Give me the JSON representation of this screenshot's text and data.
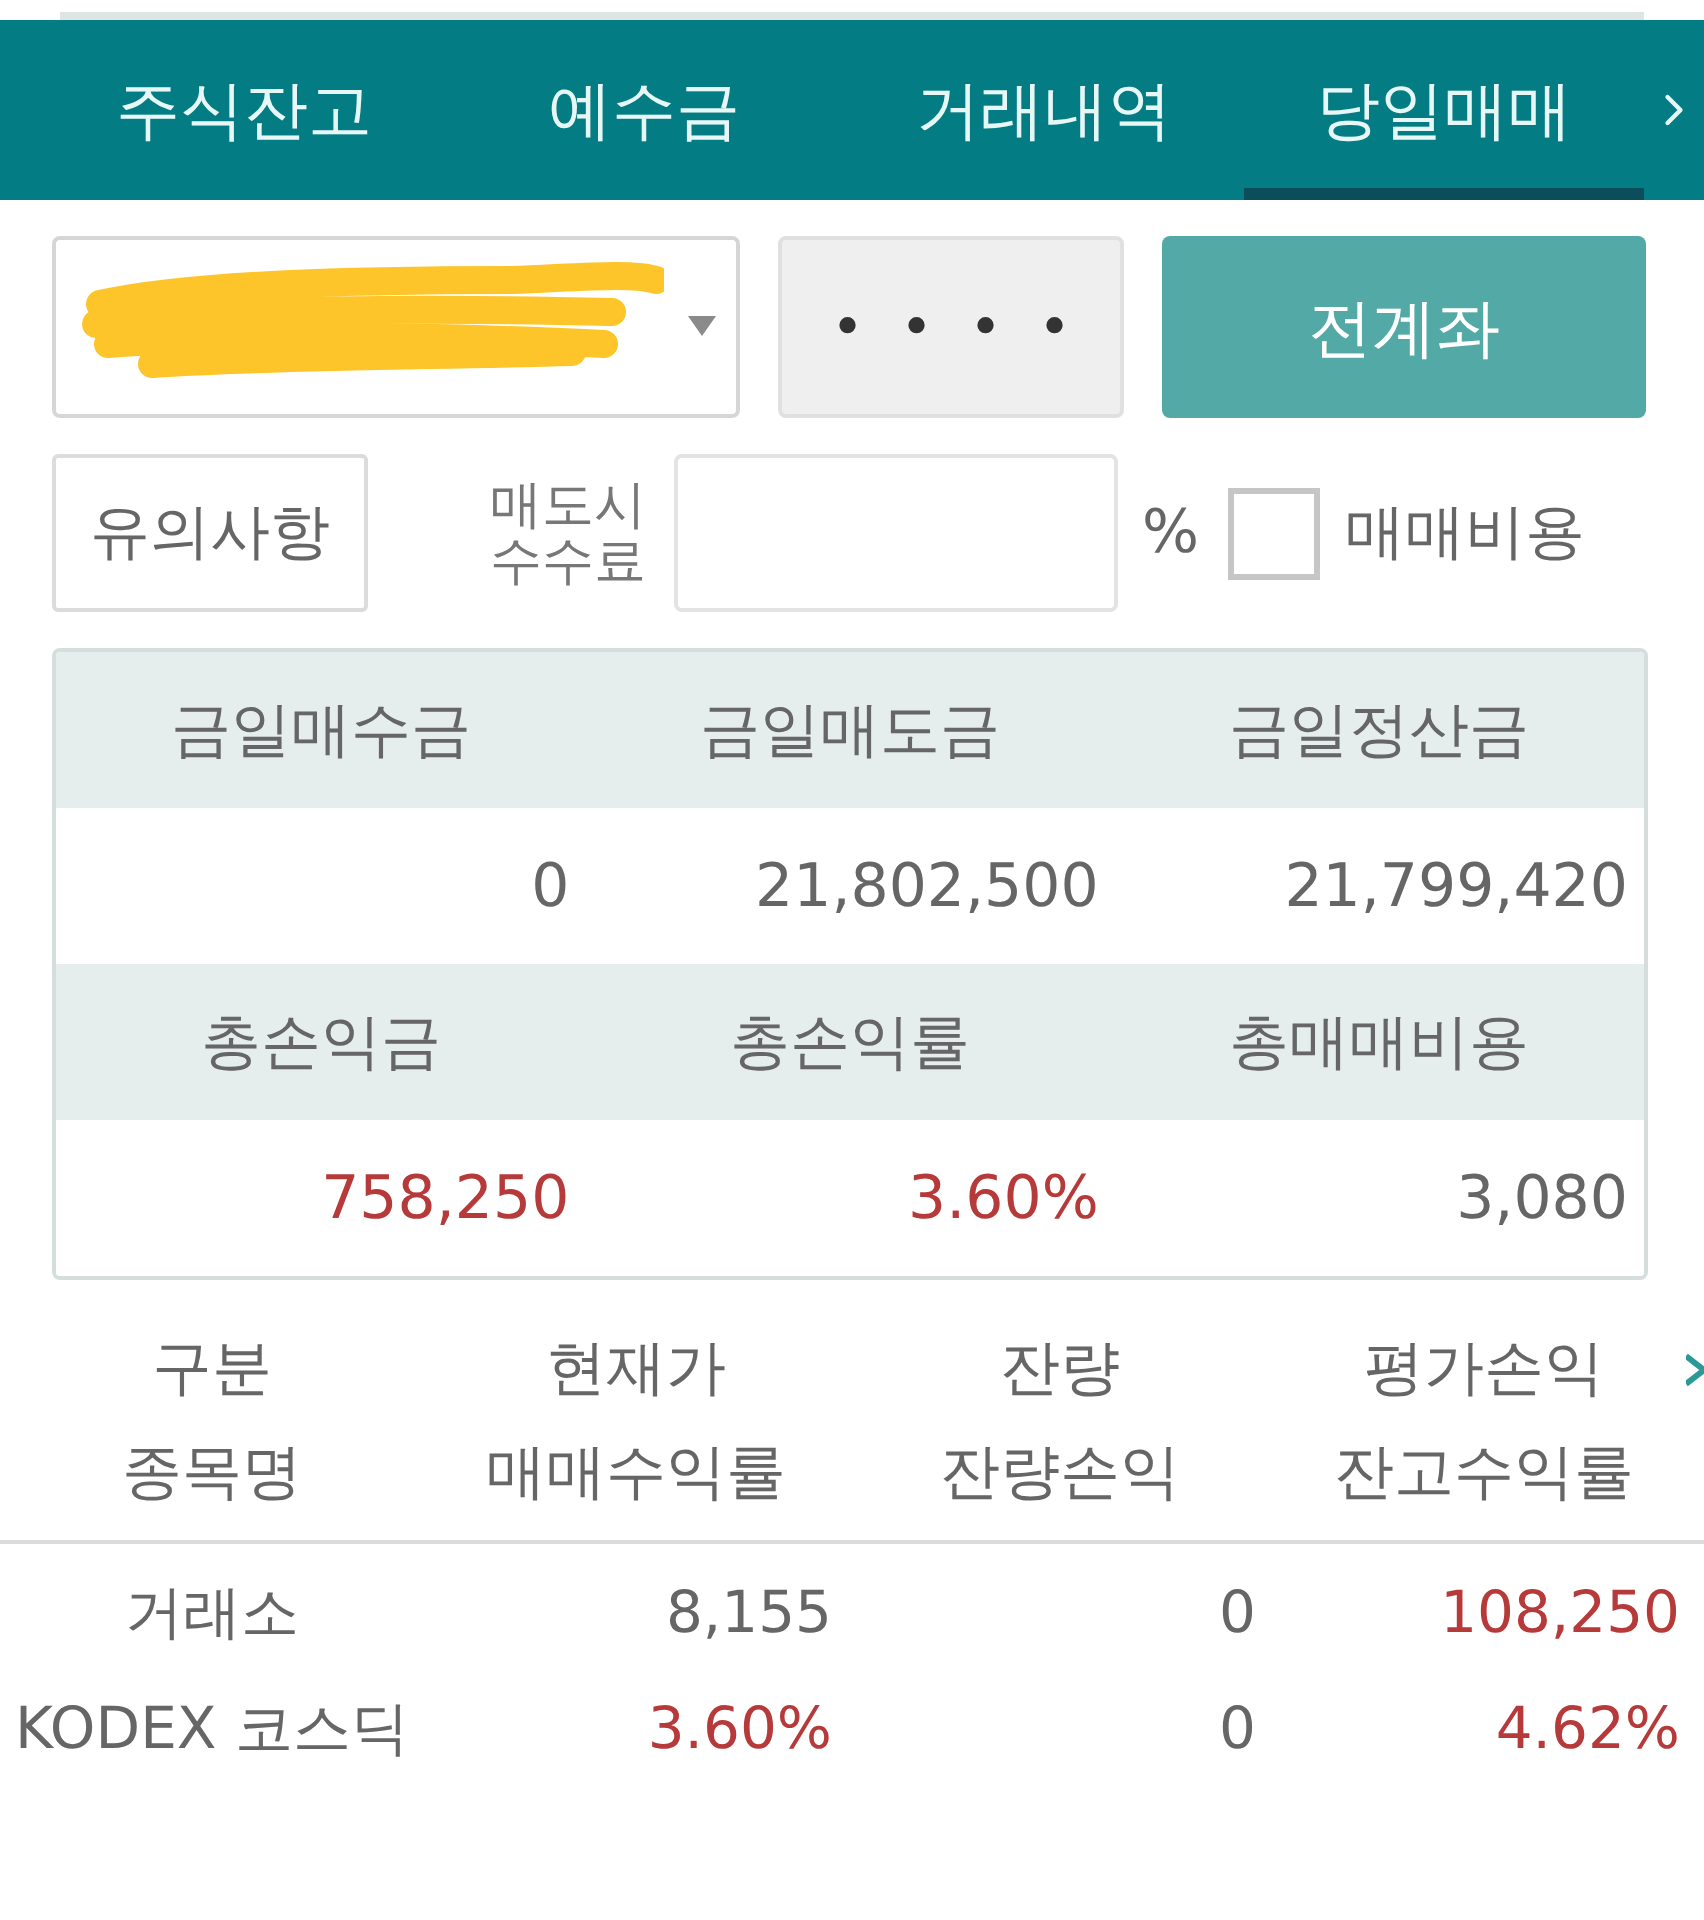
{
  "tabs": [
    {
      "label": "주식잔고",
      "selected": false
    },
    {
      "label": "예수금",
      "selected": false
    },
    {
      "label": "거래내역",
      "selected": false
    },
    {
      "label": "당일매매",
      "selected": true
    }
  ],
  "account_select": {
    "redacted": true
  },
  "password_field": {
    "value": "••••"
  },
  "all_accounts_button": "전계좌",
  "notice_button": "유의사항",
  "fee_field": {
    "label": [
      "매도시",
      "수수료"
    ],
    "unit": "%"
  },
  "trading_cost": {
    "label": "매매비용",
    "checked": false
  },
  "summary": {
    "sections": [
      {
        "headers": [
          "금일매수금",
          "금일매도금",
          "금일정산금"
        ],
        "values": [
          {
            "text": "0",
            "color": "#666666"
          },
          {
            "text": "21,802,500",
            "color": "#666666"
          },
          {
            "text": "21,799,420",
            "color": "#666666"
          }
        ]
      },
      {
        "headers": [
          "총손익금",
          "총손익률",
          "총매매비용"
        ],
        "values": [
          {
            "text": "758,250",
            "color": "#b73a3a"
          },
          {
            "text": "3.60%",
            "color": "#b73a3a"
          },
          {
            "text": "3,080",
            "color": "#666666"
          }
        ]
      }
    ]
  },
  "holdings": {
    "header_rows": [
      [
        "구분",
        "현재가",
        "잔량",
        "평가손익"
      ],
      [
        "종목명",
        "매매수익률",
        "잔량손익",
        "잔고수익률"
      ]
    ],
    "rows": [
      [
        {
          "text": "거래소",
          "color": "#666666"
        },
        {
          "text": "8,155",
          "color": "#666666"
        },
        {
          "text": "0",
          "color": "#666666"
        },
        {
          "text": "108,250",
          "color": "#b73a3a"
        }
      ],
      [
        {
          "text": "KODEX 코스딕",
          "color": "#666666"
        },
        {
          "text": "3.60%",
          "color": "#b73a3a"
        },
        {
          "text": "0",
          "color": "#666666"
        },
        {
          "text": "4.62%",
          "color": "#b73a3a"
        }
      ]
    ]
  }
}
